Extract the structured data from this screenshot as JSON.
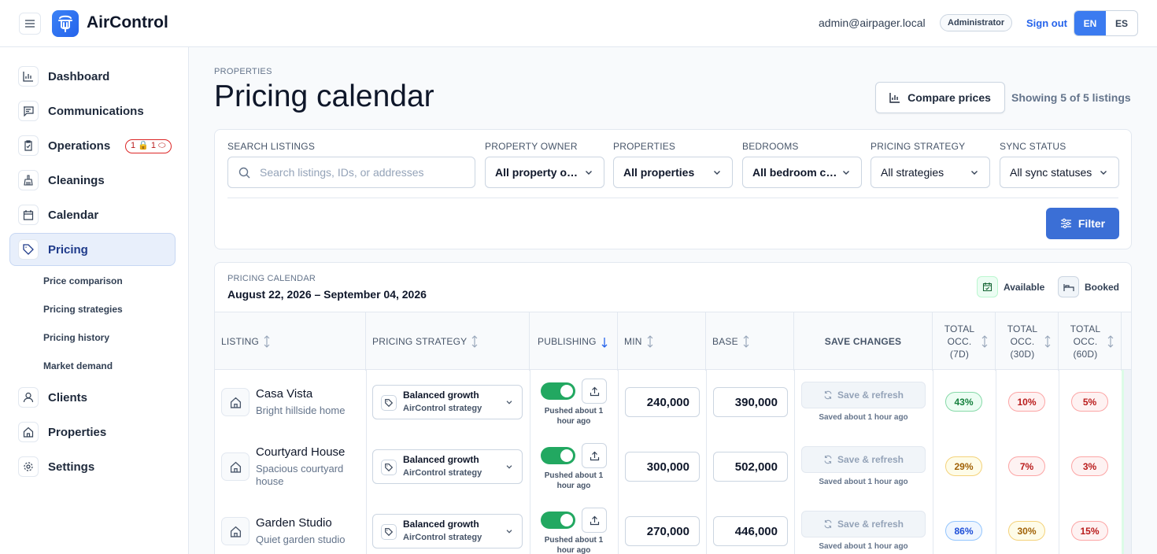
{
  "header": {
    "brand": "AirControl",
    "user_email": "admin@airpager.local",
    "role": "Administrator",
    "sign_out": "Sign out",
    "languages": [
      "EN",
      "ES"
    ],
    "active_language": "EN"
  },
  "sidebar": {
    "items": [
      {
        "label": "Dashboard",
        "icon": "bar-chart-icon"
      },
      {
        "label": "Communications",
        "icon": "message-icon"
      },
      {
        "label": "Operations",
        "icon": "clipboard-icon",
        "badge": "1 🔒 1 ⬭"
      },
      {
        "label": "Cleanings",
        "icon": "broom-icon"
      },
      {
        "label": "Calendar",
        "icon": "calendar-icon"
      },
      {
        "label": "Pricing",
        "icon": "tag-icon",
        "active": true
      },
      {
        "label": "Clients",
        "icon": "user-icon"
      },
      {
        "label": "Properties",
        "icon": "home-icon"
      },
      {
        "label": "Settings",
        "icon": "gear-icon"
      }
    ],
    "pricing_subitems": [
      "Price comparison",
      "Pricing strategies",
      "Pricing history",
      "Market demand"
    ]
  },
  "page": {
    "breadcrumb": "PROPERTIES",
    "title": "Pricing calendar",
    "compare_button": "Compare prices",
    "showing": "Showing 5 of 5 listings"
  },
  "filters": {
    "search_label": "SEARCH LISTINGS",
    "search_placeholder": "Search listings, IDs, or addresses",
    "owner_label": "PROPERTY OWNER",
    "owner_value": "All property owners",
    "properties_label": "PROPERTIES",
    "properties_value": "All properties",
    "bedrooms_label": "BEDROOMS",
    "bedrooms_value": "All bedroom counts",
    "strategy_label": "PRICING STRATEGY",
    "strategy_value": "All strategies",
    "sync_label": "SYNC STATUS",
    "sync_value": "All sync statuses",
    "filter_button": "Filter"
  },
  "calendar": {
    "label": "PRICING CALENDAR",
    "range": "August 22, 2026 – September 04, 2026",
    "legend_available": "Available",
    "legend_booked": "Booked",
    "columns": {
      "listing": "LISTING",
      "strategy": "PRICING STRATEGY",
      "publishing": "PUBLISHING",
      "min": "MIN",
      "base": "BASE",
      "save": "SAVE CHANGES",
      "occ7": "TOTAL OCC. (7D)",
      "occ30": "TOTAL OCC. (30D)",
      "occ60": "TOTAL OCC. (60D)"
    },
    "rows": [
      {
        "name": "Casa Vista",
        "desc": "Bright hillside home",
        "strategy": "Balanced growth",
        "strategy_sub": "AirControl strategy",
        "pushed": "Pushed about 1 hour ago",
        "min": "240,000",
        "base": "390,000",
        "save": "Save & refresh",
        "saved": "Saved about 1 hour ago",
        "occ7": "43%",
        "occ30": "10%",
        "occ60": "5%"
      },
      {
        "name": "Courtyard House",
        "desc": "Spacious courtyard house",
        "strategy": "Balanced growth",
        "strategy_sub": "AirControl strategy",
        "pushed": "Pushed about 1 hour ago",
        "min": "300,000",
        "base": "502,000",
        "save": "Save & refresh",
        "saved": "Saved about 1 hour ago",
        "occ7": "29%",
        "occ30": "7%",
        "occ60": "3%"
      },
      {
        "name": "Garden Studio",
        "desc": "Quiet garden studio",
        "strategy": "Balanced growth",
        "strategy_sub": "AirControl strategy",
        "pushed": "Pushed about 1 hour ago",
        "min": "270,000",
        "base": "446,000",
        "save": "Save & refresh",
        "saved": "Saved about 1 hour ago",
        "occ7": "86%",
        "occ30": "30%",
        "occ60": "15%"
      }
    ]
  },
  "colors": {
    "accent": "#3b7bf0",
    "toggle_on": "#22a861",
    "filter_button": "#3b6fd6"
  }
}
